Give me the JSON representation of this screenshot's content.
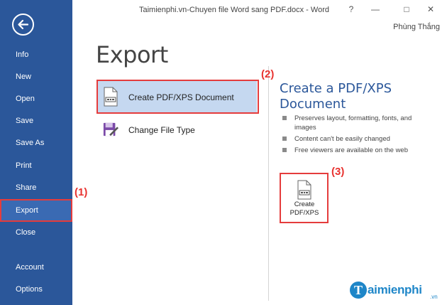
{
  "window": {
    "title": "Taimienphi.vn-Chuyen file Word sang PDF.docx - Word",
    "help_glyph": "?",
    "minimize_glyph": "—",
    "restore_glyph": "□",
    "close_glyph": "✕",
    "user": "Phùng Thắng"
  },
  "sidebar": {
    "back_icon": "back-arrow-icon",
    "items": [
      {
        "label": "Info"
      },
      {
        "label": "New"
      },
      {
        "label": "Open"
      },
      {
        "label": "Save"
      },
      {
        "label": "Save As"
      },
      {
        "label": "Print"
      },
      {
        "label": "Share"
      },
      {
        "label": "Export",
        "selected": true
      },
      {
        "label": "Close"
      },
      {
        "label": "Account"
      },
      {
        "label": "Options"
      }
    ],
    "color": "#2b579a"
  },
  "main": {
    "title": "Export",
    "options": [
      {
        "label": "Create PDF/XPS Document",
        "icon": "pdf-document-icon",
        "selected": true
      },
      {
        "label": "Change File Type",
        "icon": "change-file-type-icon",
        "selected": false
      }
    ],
    "detail": {
      "title": "Create a PDF/XPS Document",
      "bullets": [
        "Preserves layout, formatting, fonts, and images",
        "Content can't be easily changed",
        "Free viewers are available on the web"
      ],
      "create_button_label": "Create PDF/XPS"
    }
  },
  "annotations": {
    "step1": "(1)",
    "step2": "(2)",
    "step3": "(3)",
    "color": "#e53c3c"
  },
  "watermark": {
    "initial": "T",
    "text": "aimienphi",
    "suffix": ".vn"
  }
}
